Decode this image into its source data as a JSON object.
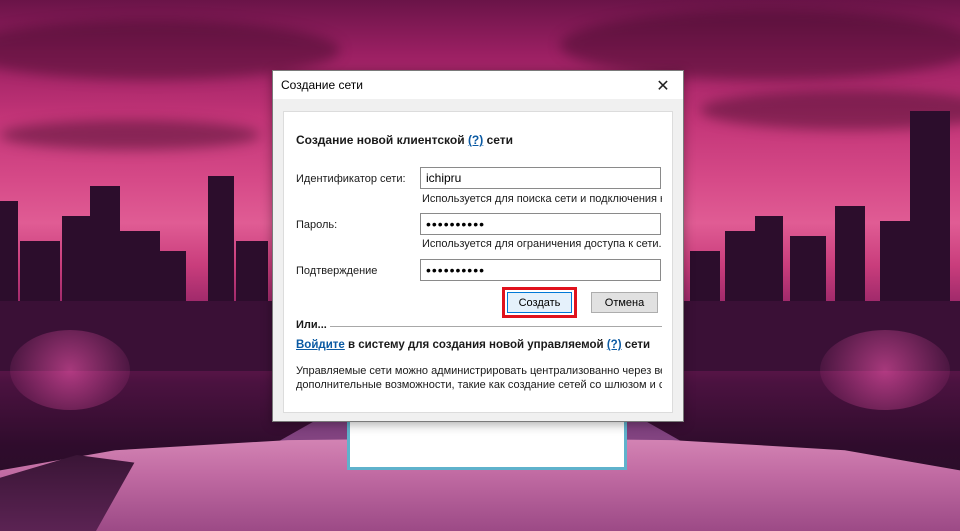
{
  "window": {
    "title": "Создание сети",
    "close_glyph": "✕"
  },
  "form": {
    "heading_prefix": "Создание новой клиентской",
    "heading_help": "(?)",
    "heading_suffix": "сети",
    "network_id": {
      "label": "Идентификатор сети:",
      "value": "ichipru",
      "hint": "Используется для поиска сети и подключения к"
    },
    "password": {
      "label": "Пароль:",
      "value": "••••••••••",
      "hint": "Используется для ограничения доступа к сети."
    },
    "confirm": {
      "label": "Подтверждение",
      "value": "••••••••••"
    },
    "create_button": "Создать",
    "cancel_button": "Отмена"
  },
  "alternative": {
    "or_label": "Или...",
    "signin_link": "Войдите",
    "signin_text": "в систему для создания новой управляемой",
    "signin_help": "(?)",
    "signin_suffix": "сети",
    "desc_line1": "Управляемые сети можно администрировать централизованно через веб-ин",
    "desc_line2": "дополнительные возможности, такие как создание сетей со шлюзом и сетей"
  },
  "colors": {
    "accent": "#0b5aa3",
    "highlight": "#e0121d"
  },
  "icons": {
    "close": "close-icon"
  }
}
